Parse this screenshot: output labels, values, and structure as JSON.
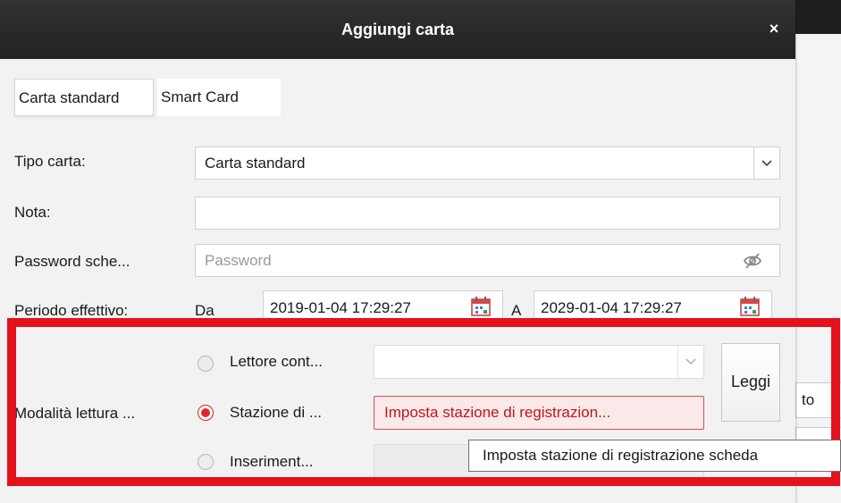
{
  "dialog": {
    "title": "Aggiungi carta",
    "close_label": "×",
    "tabs": [
      {
        "label": "Carta standard",
        "active": true
      },
      {
        "label": "Smart Card",
        "active": false
      }
    ],
    "fields": {
      "card_type": {
        "label": "Tipo carta:",
        "value": "Carta standard"
      },
      "note": {
        "label": "Nota:",
        "value": ""
      },
      "password": {
        "label": "Password sche...",
        "placeholder": "Password"
      },
      "period": {
        "label": "Periodo effettivo:",
        "from_label": "Da",
        "from_value": "2019-01-04 17:29:27",
        "to_label": "A",
        "to_value": "2029-01-04 17:29:27"
      }
    },
    "read_mode": {
      "label": "Modalità lettura ...",
      "options": [
        {
          "label": "Lettore cont...",
          "selected": false
        },
        {
          "label": "Stazione di ...",
          "selected": true
        },
        {
          "label": "Inseriment...",
          "selected": false
        }
      ],
      "reader_select_value": "",
      "station_button": "Imposta stazione di registrazion...",
      "read_button": "Leggi",
      "tooltip": "Imposta stazione di registrazione scheda"
    }
  },
  "background_window": {
    "field_text": "to"
  },
  "colors": {
    "titlebar": "#2a2a2a",
    "highlight_border": "#e3121b",
    "accent_red": "#e0262d"
  },
  "icons": {
    "close": "close-icon",
    "dropdown": "chevron-down-icon",
    "eye_hidden": "eye-off-icon",
    "calendar": "calendar-icon"
  }
}
